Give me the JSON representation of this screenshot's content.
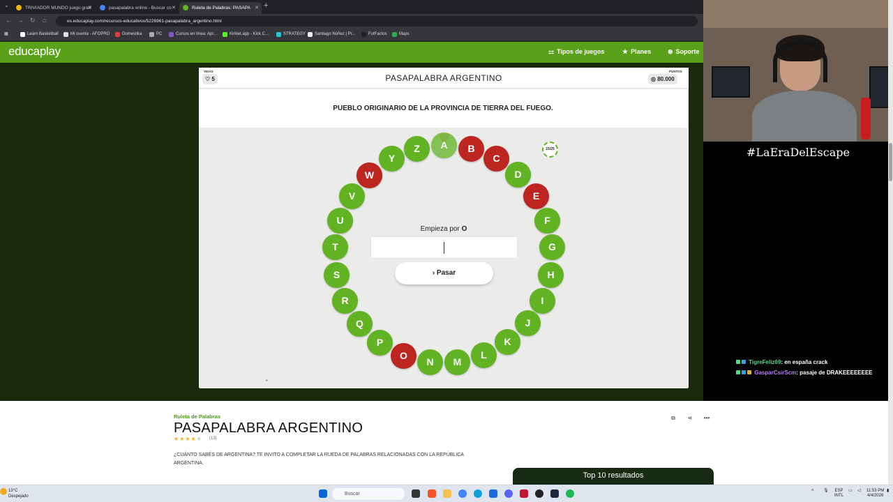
{
  "browser": {
    "tabs": [
      {
        "label": "TRIVIADOR MUNDO juego grati",
        "fav": "#f4b400",
        "active": false
      },
      {
        "label": "pasapalabra online - Buscar co",
        "fav": "#4285f4",
        "active": false
      },
      {
        "label": "Ruleta de Palabras: PASAPA",
        "fav": "#62b323",
        "active": true
      }
    ],
    "url": "es.educaplay.com/recursos-educativos/5226961-pasapalabra_argentino.html",
    "bookmarks": [
      {
        "label": "Learn Basketball",
        "color": "#ffffff"
      },
      {
        "label": "Mi cuenta - AFOPRO",
        "color": "#dddddd"
      },
      {
        "label": "Domestika",
        "color": "#e53935"
      },
      {
        "label": "PC",
        "color": "#aaaaaa"
      },
      {
        "label": "Cursos en línea: Apr...",
        "color": "#7e57c2"
      },
      {
        "label": "Kirklet.app - Kick C...",
        "color": "#53fc18"
      },
      {
        "label": "STRATEGY",
        "color": "#26c6da"
      },
      {
        "label": "Santiago Núñez | Pr...",
        "color": "#eeeeee"
      },
      {
        "label": "FutFactos",
        "color": "#222222"
      },
      {
        "label": "Maps",
        "color": "#34a853"
      }
    ]
  },
  "header": {
    "logo": "educaplay",
    "nav": [
      {
        "label": "Tipos de juegos",
        "icon": "grid-icon"
      },
      {
        "label": "Planes",
        "icon": "star-icon"
      },
      {
        "label": "Soporte",
        "icon": "help-icon"
      }
    ]
  },
  "game": {
    "lives_label": "VIDAS",
    "lives": "5",
    "points_label": "PUNTOS",
    "points": "80.000",
    "title": "PASAPALABRA ARGENTINO",
    "question": "PUEBLO ORIGINARIO DE LA PROVINCIA DE TIERRA DEL FUEGO.",
    "counter": "15/25",
    "starts_with_label": "Empieza por",
    "starts_with_letter": "O",
    "answer_value": "",
    "pass_label": "Pasar",
    "letters": [
      {
        "l": "A",
        "state": "green",
        "current": true
      },
      {
        "l": "B",
        "state": "red"
      },
      {
        "l": "C",
        "state": "red"
      },
      {
        "l": "D",
        "state": "green"
      },
      {
        "l": "E",
        "state": "red"
      },
      {
        "l": "F",
        "state": "green"
      },
      {
        "l": "G",
        "state": "green"
      },
      {
        "l": "H",
        "state": "green"
      },
      {
        "l": "I",
        "state": "green"
      },
      {
        "l": "J",
        "state": "green"
      },
      {
        "l": "K",
        "state": "green"
      },
      {
        "l": "L",
        "state": "green"
      },
      {
        "l": "M",
        "state": "green"
      },
      {
        "l": "N",
        "state": "green"
      },
      {
        "l": "O",
        "state": "red"
      },
      {
        "l": "P",
        "state": "green"
      },
      {
        "l": "Q",
        "state": "green"
      },
      {
        "l": "R",
        "state": "green"
      },
      {
        "l": "S",
        "state": "green"
      },
      {
        "l": "T",
        "state": "green"
      },
      {
        "l": "U",
        "state": "green"
      },
      {
        "l": "V",
        "state": "green"
      },
      {
        "l": "W",
        "state": "red"
      },
      {
        "l": "Y",
        "state": "green"
      },
      {
        "l": "Z",
        "state": "green"
      }
    ]
  },
  "details": {
    "category": "Ruleta de Palabras",
    "title": "PASAPALABRA ARGENTINO",
    "rating_count": "(13)",
    "description": "¿CUÁNTO SABÉS DE ARGENTINA? TE INVITO A COMPLETAR LA RUEDA DE PALABRAS RELACIONADAS CON LA REPÚBLICA ARGENTINA.",
    "top10": "Top 10 resultados"
  },
  "stream": {
    "hashtag": "#LaEraDelEscape",
    "chat": [
      {
        "user": "TigreFeliz69",
        "message": ": en españa crack"
      },
      {
        "user": "GasparCsirScm",
        "message": ": pasaje de DRAKEEEEEEEE"
      }
    ]
  },
  "taskbar": {
    "temp": "13°C",
    "weather": "Despejado",
    "search": "Buscar",
    "lang1": "ESP",
    "lang2": "INTL",
    "time": "11:53 PM",
    "date": "4/4/2026"
  }
}
